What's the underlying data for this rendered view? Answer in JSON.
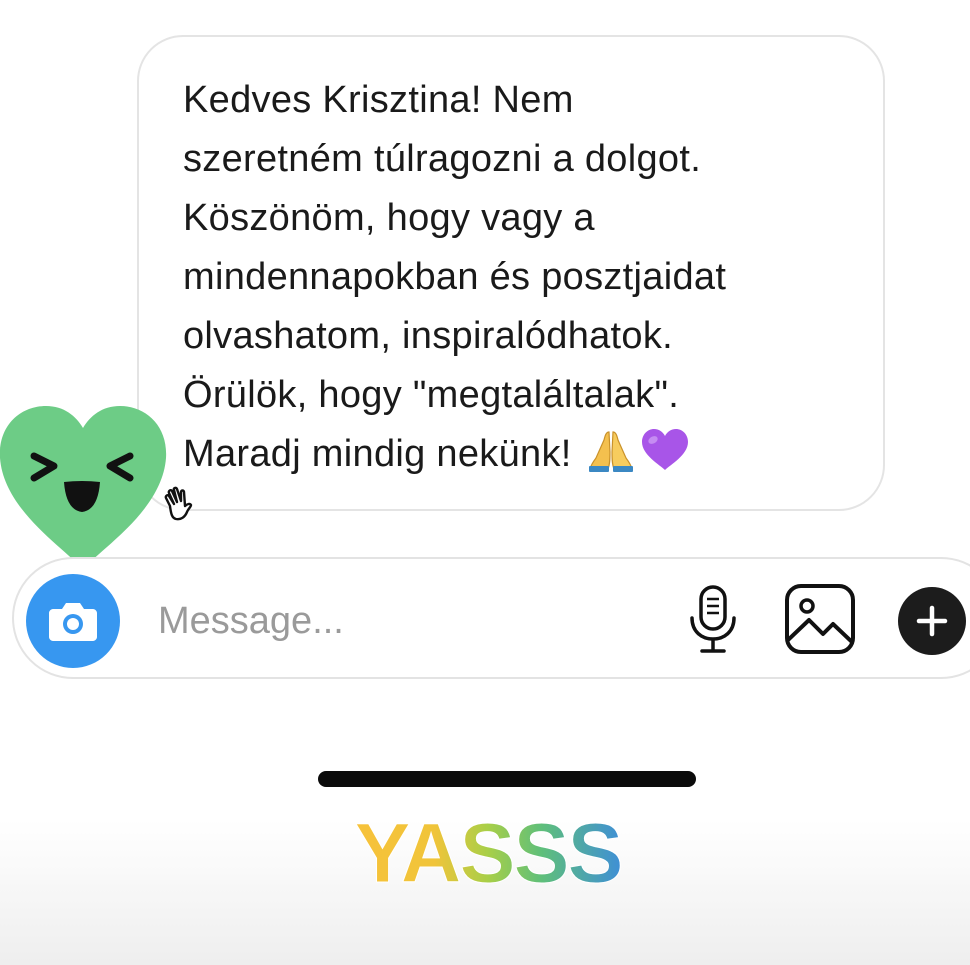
{
  "message": {
    "text": "Kedves Krisztina! Nem\nszeretném túlragozni a dolgot.\nKöszönöm, hogy vagy a\nmindennapokban és posztjaidat\nolvashatom, inspiralódhatok.\nÖrülök, hogy \"megtaláltalak\".\nMaradj mindig nekünk!",
    "emojis": [
      "🙏",
      "💜"
    ]
  },
  "composer": {
    "placeholder": "Message...",
    "value": ""
  },
  "sticker": {
    "text": "YASSS"
  },
  "colors": {
    "camera_button": "#3797f0",
    "heart_sticker": "#6dcc86",
    "plus_button": "#1c1c1c",
    "bubble_border": "#e4e4e4"
  }
}
